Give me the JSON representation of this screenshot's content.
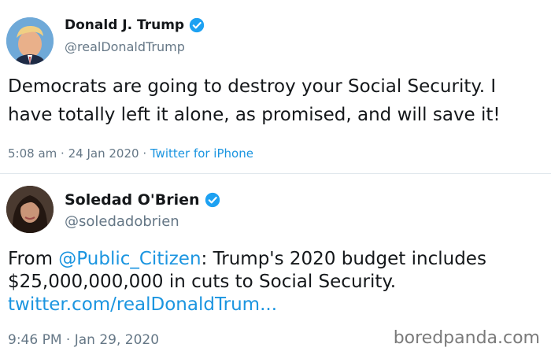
{
  "tweet1": {
    "name": "Donald J. Trump",
    "handle": "@realDonaldTrump",
    "text": "Democrats are going to destroy your Social Security. I have totally left it alone, as promised, and will save it!",
    "time": "5:08 am",
    "date": "24 Jan 2020",
    "source": "Twitter for iPhone",
    "separator": "·"
  },
  "tweet2": {
    "name": "Soledad O'Brien",
    "handle": "@soledadobrien",
    "text_prefix": "From ",
    "mention": "@Public_Citizen",
    "text_main": ": Trump's 2020 budget includes $25,000,000,000 in cuts to Social Security. ",
    "link": "twitter.com/realDonaldTrum...",
    "time": "9:46 PM",
    "date": "Jan 29, 2020",
    "separator": "·"
  },
  "watermark": "boredpanda.com",
  "colors": {
    "link": "#1b95e0",
    "secondary_text": "#657786",
    "verified_badge": "#1da1f2",
    "divider": "#e1e8ed"
  },
  "icons": [
    "verified-badge-icon",
    "avatar-trump",
    "avatar-soledad"
  ]
}
